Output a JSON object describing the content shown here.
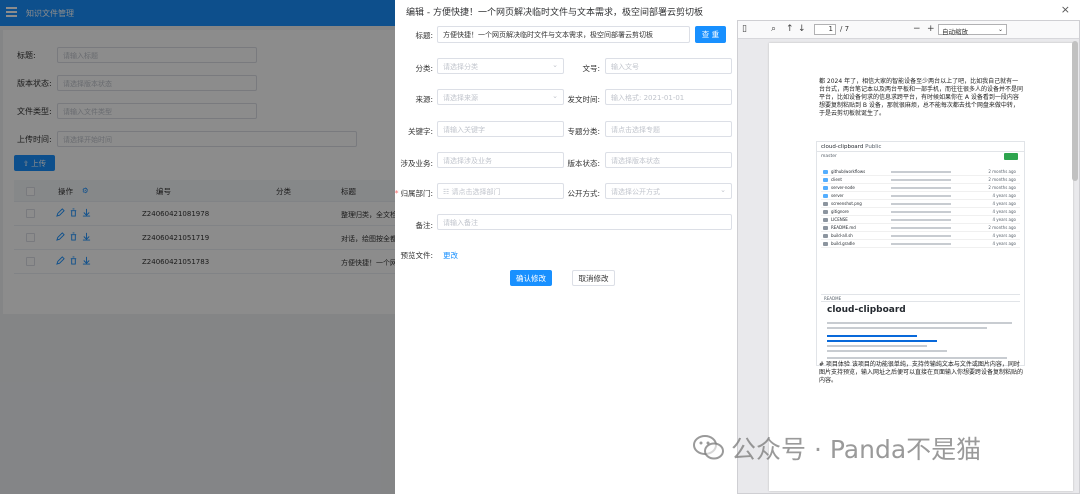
{
  "bg": {
    "app_title": "知识文件管理",
    "filters": [
      {
        "label": "标题:",
        "placeholder": "请输入标题"
      },
      {
        "label": "版本状态:",
        "placeholder": "请选择版本状态"
      },
      {
        "label": "文件类型:",
        "placeholder": "请输入文件类型"
      },
      {
        "label": "上传时间:",
        "placeholder": "请选择开始时间"
      }
    ],
    "upload_label": "上传",
    "table_headers": [
      "操作",
      "编号",
      "分类",
      "标题"
    ],
    "rows": [
      {
        "code": "Z24060421081978",
        "title": "整理归类，全文检"
      },
      {
        "code": "Z24060421051719",
        "title": "对话，绘图按全都"
      },
      {
        "code": "Z24060421051783",
        "title": "方便快捷！一个网"
      }
    ]
  },
  "dialog": {
    "title": "编辑 - 方便快捷！一个网页解决临时文件与文本需求，极空间部署云剪切板",
    "close": "×",
    "fields": {
      "title_label": "标题:",
      "title_value": "方便快捷！一个网页解决临时文件与文本需求，极空间部署云剪切板",
      "search_btn": "查 重",
      "category_label": "分类:",
      "category_ph": "请选择分类",
      "docno_label": "文号:",
      "docno_ph": "输入文号",
      "source_label": "来源:",
      "source_ph": "请选择来源",
      "date_label": "发文时间:",
      "date_ph": "输入格式: 2021-01-01",
      "keyword_label": "关键字:",
      "keyword_ph": "请输入关键字",
      "topic_label": "专题分类:",
      "topic_ph": "请点击选择专题",
      "biz_label": "涉及业务:",
      "biz_ph": "请选择涉及业务",
      "version_label": "版本状态:",
      "version_ph": "请选择版本状态",
      "dept_label": "归属部门:",
      "dept_ph": "请点击选择部门",
      "public_label": "公开方式:",
      "public_ph": "请选择公开方式",
      "remark_label": "备注:",
      "remark_ph": "请输入备注",
      "preview_label": "预览文件:",
      "preview_link": "更改"
    },
    "confirm_btn": "确认修改",
    "cancel_btn": "取消修改"
  },
  "pdf": {
    "page": "1",
    "total": "/ 7",
    "zoom": "自动缩放",
    "para1": "都 2024 年了，相信大家的智能设备至少两台以上了吧，比如我自己就有一台台式，两台笔记本以及两台平板和一部手机，而往往很多人的设备并不是同平台，比如设备何求的信息求跨平台，有时候如果你在 A 设备看到一段内容想要复制粘贴到 B 设备，那就很麻烦，总不能每次都去找个网盘来做中转，于是云剪切板就诞生了。",
    "para2": "# 项目体验 该项目的功能很单纯，支持传输纯文本与文件或图片内容，同时图片支持预览，输入网址之后便可以直接在页面输入你想要跨设备复制粘贴的内容。",
    "shot": {
      "repo": "cloud-clipboard",
      "tag": "Public",
      "branch": "master",
      "readme_tab": "README",
      "readme_title": "cloud-clipboard",
      "files": [
        "github/workflows",
        "client",
        "server-node",
        "server",
        "screenshot.png",
        "gitignore",
        "LICENSE",
        "README.md",
        "build-all.sh",
        "build.gradle"
      ],
      "dates": [
        "2 months ago",
        "2 months ago",
        "2 months ago",
        "4 years ago",
        "4 years ago",
        "4 years ago",
        "4 years ago",
        "2 months ago",
        "4 years ago",
        "4 years ago"
      ]
    }
  },
  "watermark": "公众号 · Panda不是猫"
}
